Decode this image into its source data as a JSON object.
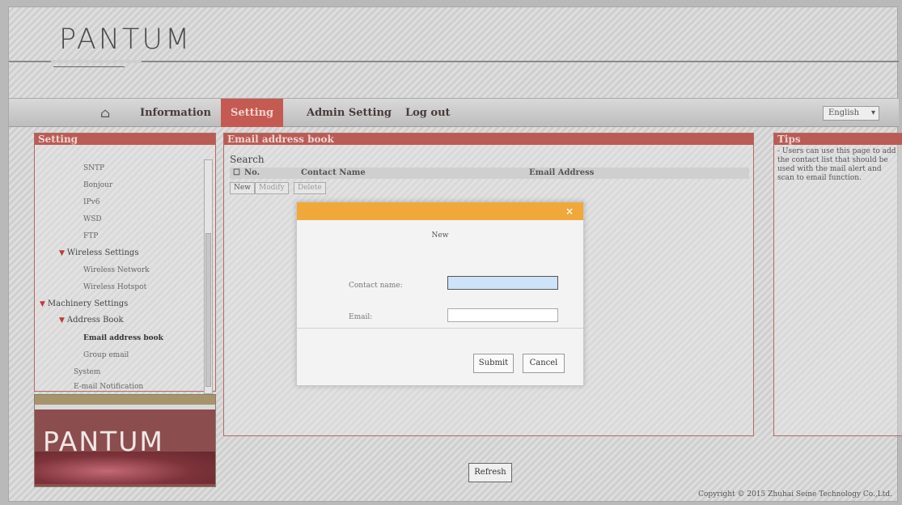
{
  "header": {
    "brand": "PANTUM"
  },
  "nav": {
    "home_icon": "home-icon",
    "items": [
      {
        "label": "Information"
      },
      {
        "label": "Setting",
        "active": true
      },
      {
        "label": "Admin Setting"
      },
      {
        "label": "Log out"
      }
    ],
    "language": "English"
  },
  "left_panel": {
    "title": "Setting",
    "items": [
      {
        "label": "SNTP",
        "level": 2
      },
      {
        "label": "Bonjour",
        "level": 2
      },
      {
        "label": "IPv6",
        "level": 2
      },
      {
        "label": "WSD",
        "level": 2
      },
      {
        "label": "FTP",
        "level": 2
      },
      {
        "label": "Wireless Settings",
        "level": 1,
        "expanded": true
      },
      {
        "label": "Wireless Network",
        "level": 2
      },
      {
        "label": "Wireless Hotspot",
        "level": 2
      },
      {
        "label": "Machinery Settings",
        "level": 0,
        "expanded": true
      },
      {
        "label": "Address Book",
        "level": 1,
        "expanded": true
      },
      {
        "label": "Email address book",
        "level": 2,
        "selected": true
      },
      {
        "label": "Group email",
        "level": 2
      },
      {
        "label": "System",
        "level": 1
      },
      {
        "label": "E-mail Notification",
        "level": 1
      }
    ],
    "logo": "PANTUM"
  },
  "main": {
    "title": "Email address book",
    "search_label": "Search",
    "columns": [
      "No.",
      "Contact Name",
      "Email Address"
    ],
    "buttons": [
      "New",
      "Modify",
      "Delete"
    ]
  },
  "tips": {
    "title": "Tips",
    "text": "- Users can use this page to add the contact list that should be used with the mail alert and scan to email function."
  },
  "modal": {
    "title": "New",
    "fields": [
      {
        "label": "Contact name:",
        "value": ""
      },
      {
        "label": "Email:",
        "value": ""
      }
    ],
    "submit_label": "Submit",
    "cancel_label": "Cancel"
  },
  "footer": {
    "refresh_label": "Refresh",
    "copyright": "Copyright © 2015 Zhuhai Seine Technology Co.,Ltd."
  }
}
